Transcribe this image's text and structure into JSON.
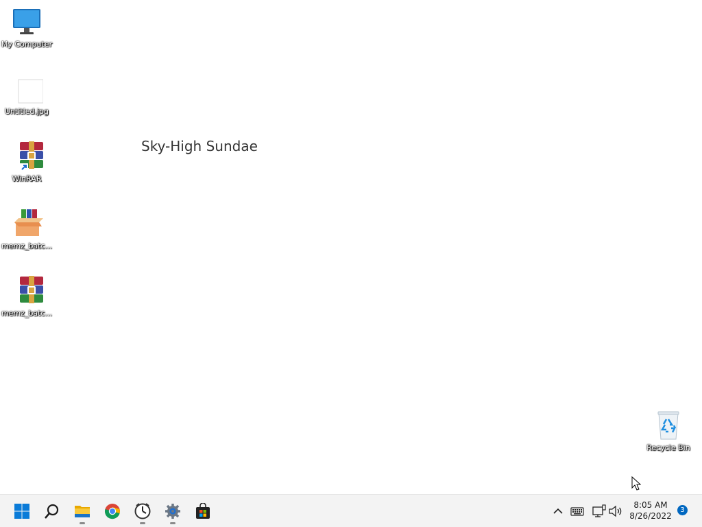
{
  "desktop": {
    "icons": [
      {
        "label": "My Computer",
        "icon": "monitor-icon"
      },
      {
        "label": "Untitled.jpg",
        "icon": "image-file-icon"
      },
      {
        "label": "WinRAR",
        "icon": "winrar-icon"
      },
      {
        "label": "memz_batc...",
        "icon": "archive-box-icon"
      },
      {
        "label": "memz_batc...",
        "icon": "winrar-icon"
      }
    ],
    "recycle_bin": {
      "label": "Recycle Bin",
      "icon": "recycle-bin-icon"
    },
    "overlay_text": "Sky-High Sundae"
  },
  "taskbar": {
    "apps": [
      "start-icon",
      "search-icon",
      "file-explorer-icon",
      "chrome-icon",
      "clock-app-icon",
      "settings-icon",
      "store-icon"
    ],
    "tray": {
      "time": "8:05 AM",
      "date": "8/26/2022",
      "notification_count": "3"
    }
  },
  "colors": {
    "accent": "#0067c0",
    "taskbar_bg": "#f3f3f3",
    "folder": "#f5c542"
  }
}
